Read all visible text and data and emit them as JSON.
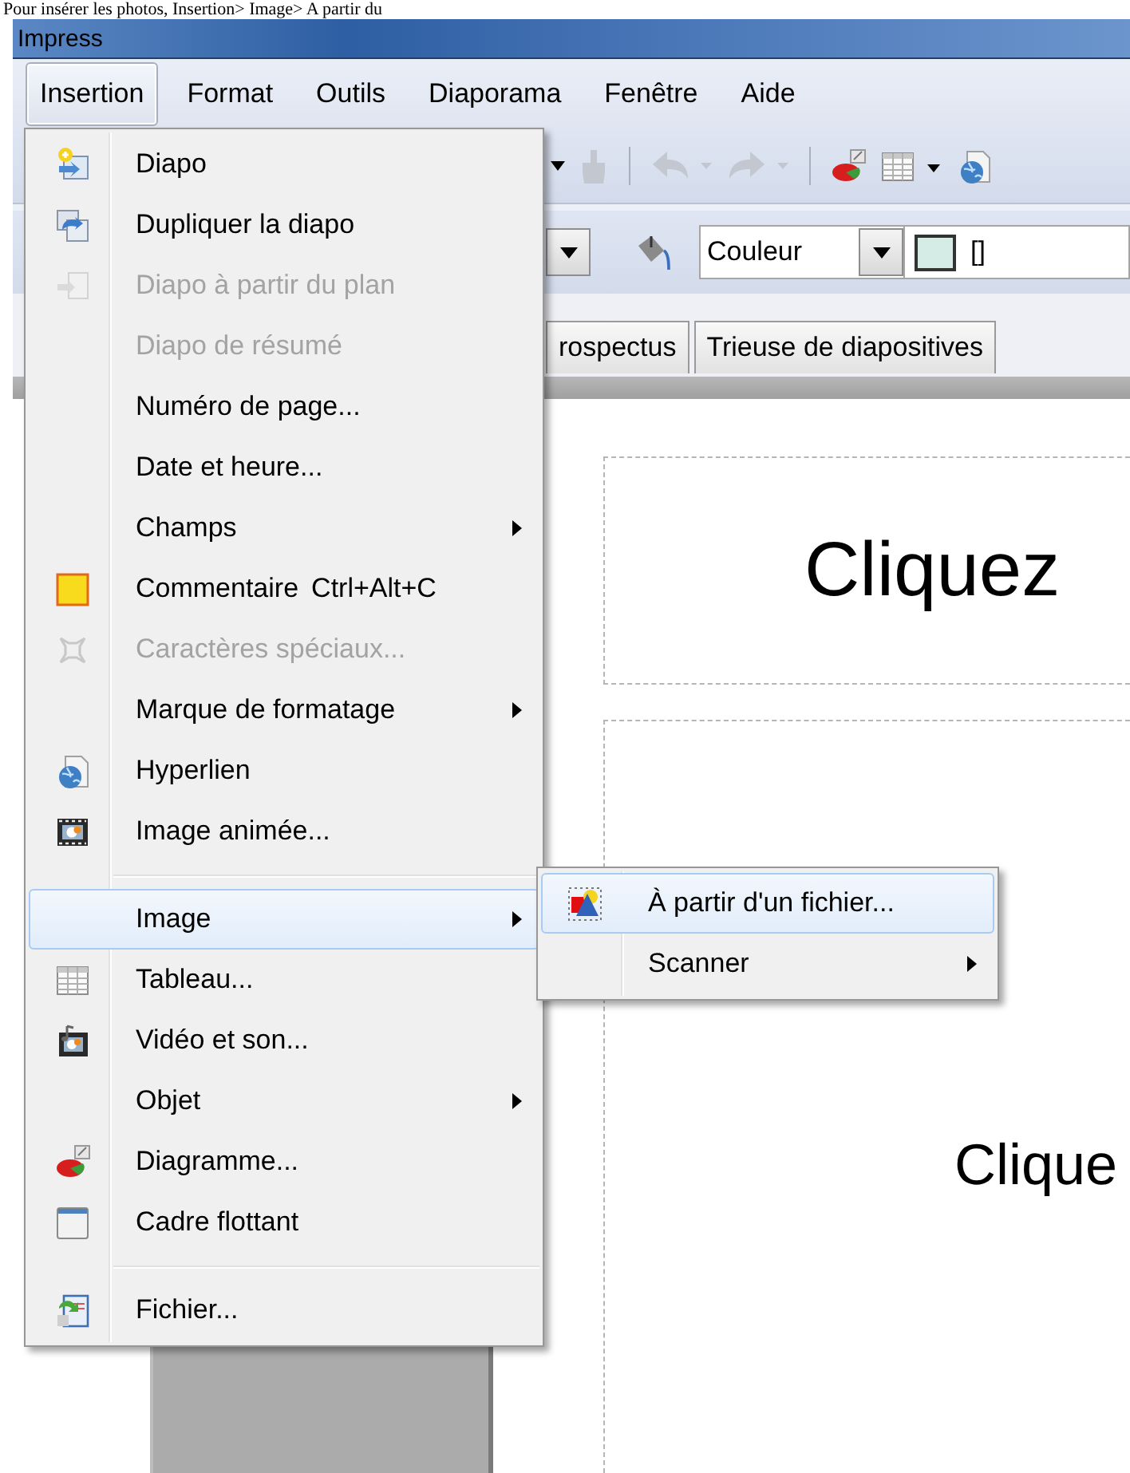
{
  "caption": "Pour insérer les photos, Insertion> Image> A partir du",
  "window": {
    "title": "Impress"
  },
  "menubar": [
    {
      "label": "Insertion",
      "selected": true
    },
    {
      "label": "Format",
      "selected": false
    },
    {
      "label": "Outils",
      "selected": false
    },
    {
      "label": "Diaporama",
      "selected": false
    },
    {
      "label": "Fenêtre",
      "selected": false
    },
    {
      "label": "Aide",
      "selected": false
    }
  ],
  "toolbar": [
    {
      "kind": "dropdown"
    },
    {
      "kind": "brush",
      "disabled": true
    },
    {
      "kind": "undo",
      "disabled": true
    },
    {
      "kind": "redo",
      "disabled": true
    },
    {
      "kind": "chart",
      "disabled": false
    },
    {
      "kind": "table",
      "disabled": false
    },
    {
      "kind": "hyperlink",
      "disabled": false
    }
  ],
  "format_bar": {
    "area_style": "Couleur",
    "fill_value": "[]"
  },
  "view_tabs": [
    {
      "label": "rospectus",
      "selected": false
    },
    {
      "label": "Trieuse de diapositives",
      "selected": false
    }
  ],
  "slide": {
    "title_placeholder": "Cliquez",
    "content_placeholder": "Clique"
  },
  "menu": {
    "items": [
      {
        "kind": "item",
        "label": "Diapo",
        "disabled": false,
        "submenu": false,
        "selected": false
      },
      {
        "kind": "item",
        "label": "Dupliquer la diapo",
        "disabled": false,
        "submenu": false,
        "selected": false
      },
      {
        "kind": "item",
        "label": "Diapo à partir du plan",
        "disabled": true,
        "submenu": false,
        "selected": false
      },
      {
        "kind": "item",
        "label": "Diapo de résumé",
        "disabled": true,
        "submenu": false,
        "selected": false
      },
      {
        "kind": "item",
        "label": "Numéro de page...",
        "disabled": false,
        "submenu": false,
        "selected": false
      },
      {
        "kind": "item",
        "label": "Date et heure...",
        "disabled": false,
        "submenu": false,
        "selected": false
      },
      {
        "kind": "item",
        "label": "Champs",
        "disabled": false,
        "submenu": true,
        "selected": false
      },
      {
        "kind": "item",
        "label": "Commentaire",
        "shortcut": "Ctrl+Alt+C",
        "disabled": false,
        "submenu": false,
        "selected": false
      },
      {
        "kind": "item",
        "label": "Caractères spéciaux...",
        "disabled": true,
        "submenu": false,
        "selected": false
      },
      {
        "kind": "item",
        "label": "Marque de formatage",
        "disabled": false,
        "submenu": true,
        "selected": false
      },
      {
        "kind": "item",
        "label": "Hyperlien",
        "disabled": false,
        "submenu": false,
        "selected": false
      },
      {
        "kind": "item",
        "label": "Image animée...",
        "disabled": false,
        "submenu": false,
        "selected": false
      },
      {
        "kind": "separator"
      },
      {
        "kind": "item",
        "label": "Image",
        "disabled": false,
        "submenu": true,
        "selected": true
      },
      {
        "kind": "item",
        "label": "Tableau...",
        "disabled": false,
        "submenu": false,
        "selected": false
      },
      {
        "kind": "item",
        "label": "Vidéo et son...",
        "disabled": false,
        "submenu": false,
        "selected": false
      },
      {
        "kind": "item",
        "label": "Objet",
        "disabled": false,
        "submenu": true,
        "selected": false
      },
      {
        "kind": "item",
        "label": "Diagramme...",
        "disabled": false,
        "submenu": false,
        "selected": false
      },
      {
        "kind": "item",
        "label": "Cadre flottant",
        "disabled": false,
        "submenu": false,
        "selected": false
      },
      {
        "kind": "separator"
      },
      {
        "kind": "item",
        "label": "Fichier...",
        "disabled": false,
        "submenu": false,
        "selected": false
      }
    ]
  },
  "submenu": {
    "items": [
      {
        "kind": "item",
        "label": "À partir d'un fichier...",
        "disabled": false,
        "submenu": false,
        "selected": true
      },
      {
        "kind": "item",
        "label": "Scanner",
        "disabled": false,
        "submenu": true,
        "selected": false
      }
    ]
  }
}
